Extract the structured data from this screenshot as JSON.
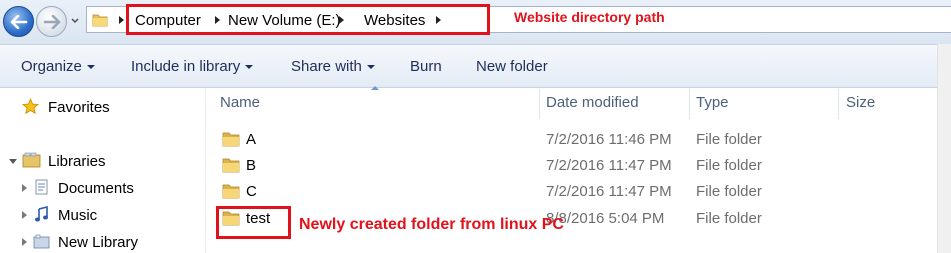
{
  "address_bar": {
    "crumbs": [
      "Computer",
      "New Volume (E:)",
      "Websites"
    ]
  },
  "annotations": {
    "path_note": "Website directory path",
    "new_folder_note": "Newly created folder from linux PC",
    "color": "#e0121b"
  },
  "toolbar": {
    "organize": "Organize",
    "include_in_library": "Include in library",
    "share_with": "Share with",
    "burn": "Burn",
    "new_folder": "New folder"
  },
  "nav": {
    "favorites": "Favorites",
    "libraries": "Libraries",
    "library_items": [
      "Documents",
      "Music",
      "New Library"
    ]
  },
  "columns": {
    "name": "Name",
    "date_modified": "Date modified",
    "type": "Type",
    "size": "Size"
  },
  "files": [
    {
      "name": "A",
      "date": "7/2/2016 11:46 PM",
      "type": "File folder"
    },
    {
      "name": "B",
      "date": "7/2/2016 11:47 PM",
      "type": "File folder"
    },
    {
      "name": "C",
      "date": "7/2/2016 11:47 PM",
      "type": "File folder"
    },
    {
      "name": "test",
      "date": "8/8/2016 5:04 PM",
      "type": "File folder"
    }
  ],
  "icons": {
    "back": "back-arrow-icon",
    "forward": "forward-arrow-icon",
    "folder": "folder-icon",
    "favorites": "star-icon",
    "libraries": "libraries-icon",
    "documents": "documents-icon",
    "music": "music-icon",
    "new_library": "library-icon"
  }
}
